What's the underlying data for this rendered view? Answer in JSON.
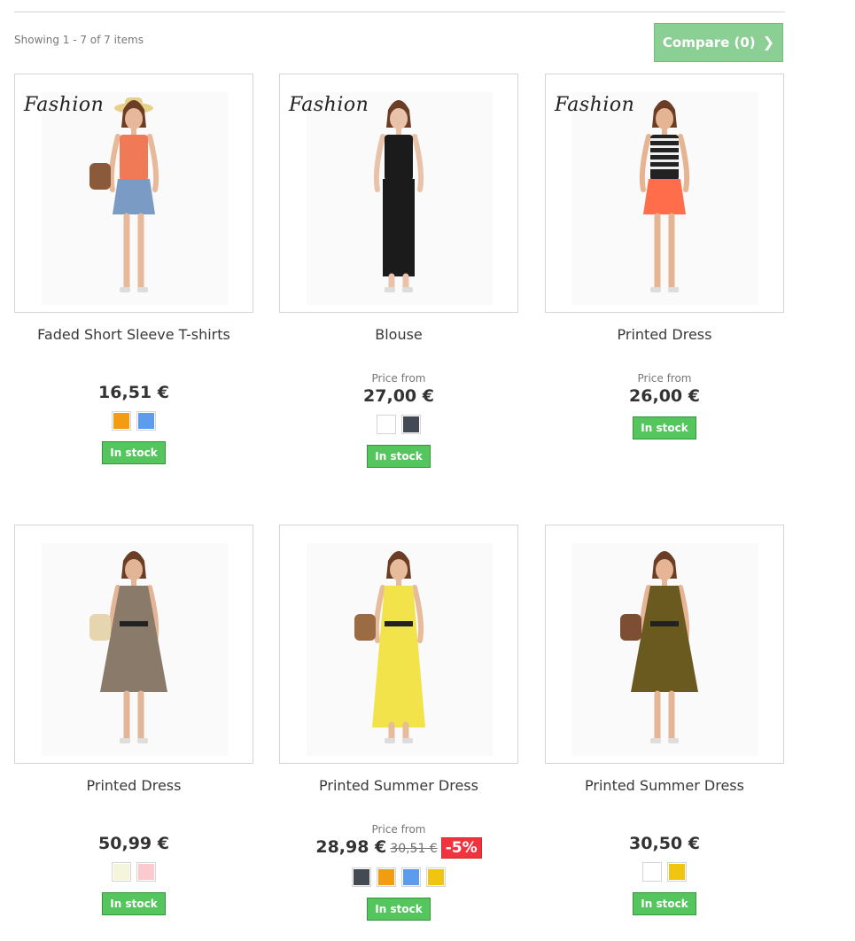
{
  "header": {
    "count_text": "Showing 1 - 7 of 7 items",
    "compare_label": "Compare (0)"
  },
  "products": [
    {
      "name": "Faded Short Sleeve T-shirts",
      "price_from": "",
      "price": "16,51 €",
      "old_price": "",
      "discount": "",
      "swatches": [
        "#f39c11",
        "#5d9cec"
      ],
      "stock": "In stock",
      "brand": "Fashion"
    },
    {
      "name": "Blouse",
      "price_from": "Price from",
      "price": "27,00 €",
      "old_price": "",
      "discount": "",
      "swatches": [
        "#ffffff",
        "#434a54"
      ],
      "stock": "In stock",
      "brand": "Fashion"
    },
    {
      "name": "Printed Dress",
      "price_from": "Price from",
      "price": "26,00 €",
      "old_price": "",
      "discount": "",
      "swatches": [],
      "stock": "In stock",
      "brand": "Fashion"
    },
    {
      "name": "Printed Dress",
      "price_from": "",
      "price": "50,99 €",
      "old_price": "",
      "discount": "",
      "swatches": [
        "#f5f5dc",
        "#fcc9cf"
      ],
      "stock": "In stock",
      "brand": ""
    },
    {
      "name": "Printed Summer Dress",
      "price_from": "Price from",
      "price": "28,98 €",
      "old_price": "30,51 €",
      "discount": "-5%",
      "swatches": [
        "#434a54",
        "#f39c11",
        "#5d9cec",
        "#f1c40f"
      ],
      "stock": "In stock",
      "brand": ""
    },
    {
      "name": "Printed Summer Dress",
      "price_from": "",
      "price": "30,50 €",
      "old_price": "",
      "discount": "",
      "swatches": [
        "#ffffff",
        "#f1c40f"
      ],
      "stock": "In stock",
      "brand": ""
    }
  ],
  "colors": {
    "accent_green": "#55c65e",
    "discount_red": "#f13340",
    "compare_bg": "#8ccf94"
  }
}
